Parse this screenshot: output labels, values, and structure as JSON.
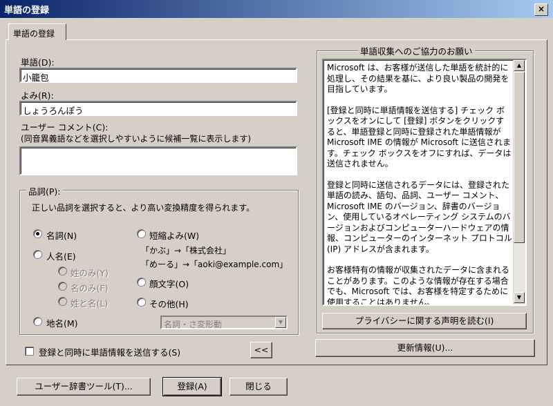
{
  "window": {
    "title": "単語の登録",
    "close_label": "×"
  },
  "tab": {
    "label": "単語の登録"
  },
  "form": {
    "word_label": "単語(D):",
    "word_value": "小籠包",
    "reading_label": "よみ(R):",
    "reading_value": "しょうろんぽう",
    "comment_label": "ユーザー コメント(C):",
    "comment_hint": "(同音異義語などを選択しやすいように候補一覧に表示します)",
    "comment_value": ""
  },
  "pos": {
    "legend": "品詞(P):",
    "description": "正しい品詞を選択すると、より高い変換精度を得られます。",
    "noun": "名詞(N)",
    "person": "人名(E)",
    "surname_only": "姓のみ(Y)",
    "given_only": "名のみ(F)",
    "surname_given": "姓と名(L)",
    "place": "地名(M)",
    "abbrev": "短縮よみ(W)",
    "abbrev_example_1": "「かぶ」→「株式会社」",
    "abbrev_example_2": "「めーる」→「aoki@example.com」",
    "emoticon": "顔文字(O)",
    "other": "その他(H)",
    "other_select": "名詞・さ変形動"
  },
  "send_check_label": "登録と同時に単語情報を送信する(S)",
  "collapse_button": "<<",
  "info": {
    "legend": "単語収集へのご協力のお願い",
    "paragraphs": [
      "Microsoft は、お客様が送信した単語を統計的に処理し、その結果を基に、より良い製品の開発を目指しています。",
      "[登録と同時に単語情報を送信する] チェック ボックスをオンにして [登録] ボタンをクリックすると、単語登録と同時に登録された単語情報が Microsoft IME の情報が Microsoft に送信されます。チェック ボックスをオフにすれば、データは送信されません。",
      "登録と同時に送信されるデータには、登録された単語の読み、語句、品詞、ユーザー コメント、Microsoft IME のバージョン、辞書のバージョン、使用しているオペレーティング システムのバージョンおよびコンピューターハードウェアの情報、コンピューターのインターネット プロトコル (IP) アドレスが含まれます。",
      "お客様特有の情報が収集されたデータに含まれることがあります。このような情報が存在する場合でも、Microsoft では、お客様を特定するために使用することはありません。"
    ],
    "privacy_button": "プライバシーに関する声明を読む(I)",
    "update_button": "更新情報(U)..."
  },
  "bottom": {
    "dict_tool_button": "ユーザー辞書ツール(T)...",
    "register_button": "登録(A)",
    "close_button": "閉じる"
  }
}
